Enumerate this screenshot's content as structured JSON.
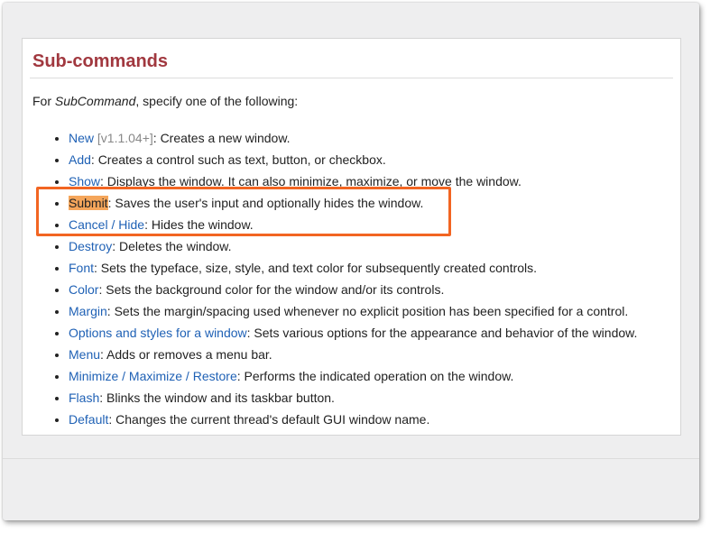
{
  "section": {
    "title": "Sub-commands",
    "intro_prefix": "For ",
    "intro_em": "SubCommand",
    "intro_suffix": ", specify one of the following:"
  },
  "items": [
    {
      "link": "New",
      "version": "[v1.1.04+]",
      "desc": ": Creates a new window."
    },
    {
      "link": "Add",
      "desc": ": Creates a control such as text, button, or checkbox."
    },
    {
      "link": "Show",
      "desc": ": Displays the window. It can also minimize, maximize, or move the window."
    },
    {
      "link": "Submit",
      "desc": ": Saves the user's input and optionally hides the window.",
      "highlighted": true
    },
    {
      "link": "Cancel",
      "sep": " / ",
      "link2": "Hide",
      "desc": ": Hides the window."
    },
    {
      "link": "Destroy",
      "desc": ": Deletes the window."
    },
    {
      "link": "Font",
      "desc": ": Sets the typeface, size, style, and text color for subsequently created controls."
    },
    {
      "link": "Color",
      "desc": ": Sets the background color for the window and/or its controls."
    },
    {
      "link": "Margin",
      "desc": ": Sets the margin/spacing used whenever no explicit position has been specified for a control."
    },
    {
      "link": "Options and styles for a window",
      "desc": ": Sets various options for the appearance and behavior of the window."
    },
    {
      "link": "Menu",
      "desc": ": Adds or removes a menu bar."
    },
    {
      "link": "Minimize",
      "sep": " / ",
      "link2": "Maximize",
      "sep2": " / ",
      "link3": "Restore",
      "desc": ": Performs the indicated operation on the window."
    },
    {
      "link": "Flash",
      "desc": ": Blinks the window and its taskbar button."
    },
    {
      "link": "Default",
      "desc": ": Changes the current thread's default GUI window name."
    }
  ],
  "colors": {
    "heading": "#a1383f",
    "link": "#1f61b5",
    "highlight": "#f5a65b",
    "annotation_box": "#f26522"
  }
}
